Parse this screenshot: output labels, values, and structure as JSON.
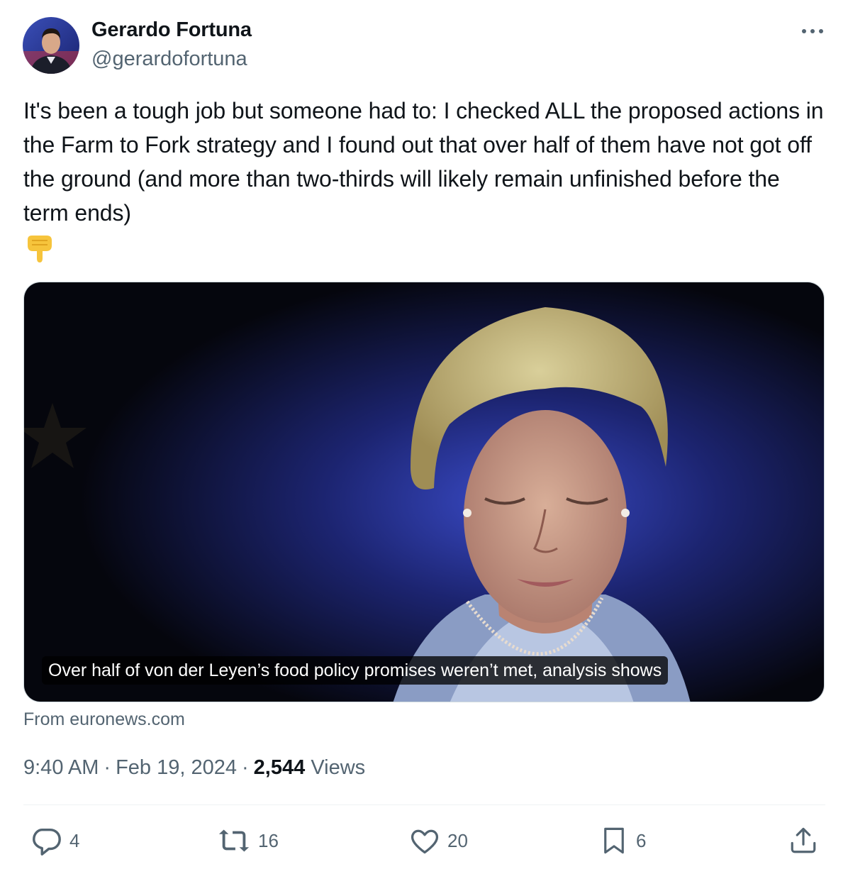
{
  "author": {
    "name": "Gerardo Fortuna",
    "handle": "@gerardofortuna"
  },
  "tweet": {
    "text": "It's been a tough job but someone had to: I checked ALL the proposed actions in the Farm to Fork strategy and I found out that over half of them have not got off the ground (and more than two-thirds will likely remain unfinished before the term ends)",
    "emoji": "backhand-index-pointing-down"
  },
  "card": {
    "caption": "Over half of von der Leyen’s food policy promises weren’t met, analysis shows",
    "source": "From euronews.com"
  },
  "meta": {
    "time": "9:40 AM",
    "date": "Feb 19, 2024",
    "views_count": "2,544",
    "views_label": "Views",
    "separator": "·"
  },
  "actions": {
    "replies": "4",
    "reposts": "16",
    "likes": "20",
    "bookmarks": "6"
  },
  "icons": [
    "more-icon",
    "reply-icon",
    "repost-icon",
    "like-icon",
    "bookmark-icon",
    "share-icon"
  ],
  "colors": {
    "primary_text": "#0f1419",
    "secondary_text": "#536471",
    "divider": "#eff3f4"
  }
}
